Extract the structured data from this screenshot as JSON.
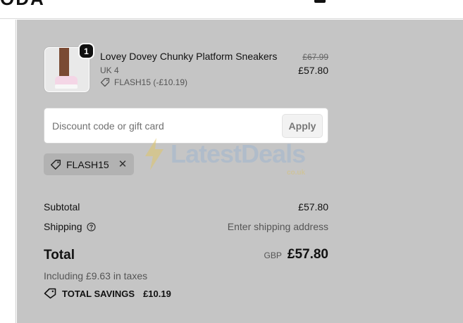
{
  "header": {
    "logo": "ODA"
  },
  "product": {
    "quantity": "1",
    "name": "Lovey Dovey Chunky Platform Sneakers",
    "variant": "UK 4",
    "discount_line": "FLASH15 (-£10.19)",
    "original_price": "£67.99",
    "price": "£57.80"
  },
  "discount": {
    "placeholder": "Discount code or gift card",
    "value": "",
    "apply_label": "Apply",
    "applied_code": "FLASH15"
  },
  "watermark": {
    "text": "LatestDeals",
    "sub": "co.uk"
  },
  "summary": {
    "subtotal_label": "Subtotal",
    "subtotal_value": "£57.80",
    "shipping_label": "Shipping",
    "shipping_value": "Enter shipping address",
    "total_label": "Total",
    "currency": "GBP",
    "total_value": "£57.80",
    "taxes": "Including £9.63 in taxes",
    "savings_label": "TOTAL SAVINGS",
    "savings_value": "£10.19"
  },
  "colors": {
    "summary_bg": "#c5c5c5",
    "chip_bg": "#b2b2b2",
    "text": "#111111"
  }
}
